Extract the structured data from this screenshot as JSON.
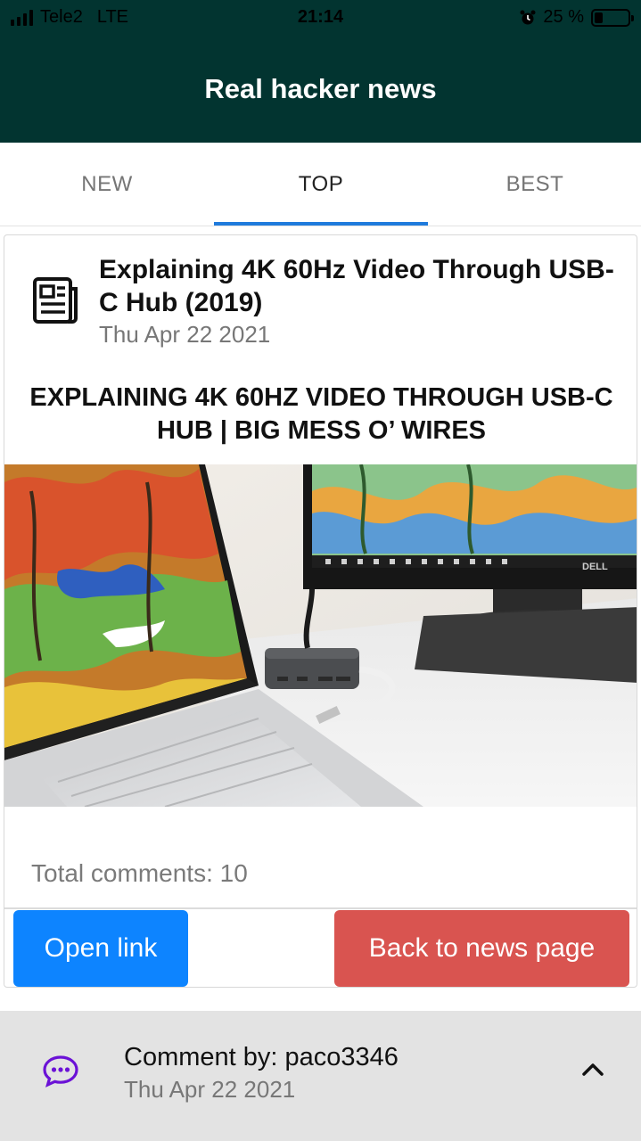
{
  "status_bar": {
    "carrier": "Tele2",
    "network": "LTE",
    "time": "21:14",
    "battery_text": "25 %",
    "battery_level": 0.25
  },
  "app": {
    "title": "Real hacker news"
  },
  "tabs": [
    {
      "label": "NEW",
      "active": false
    },
    {
      "label": "TOP",
      "active": true
    },
    {
      "label": "BEST",
      "active": false
    }
  ],
  "story": {
    "title": "Explaining 4K 60Hz Video Through USB-C Hub (2019)",
    "date": "Thu Apr 22 2021",
    "link_title": "EXPLAINING 4K 60HZ VIDEO THROUGH USB-C HUB | BIG MESS O’ WIRES",
    "image_logo_text": "DELL",
    "comments_text": "Total comments: 10",
    "open_link_label": "Open link",
    "back_label": "Back to news page"
  },
  "comment": {
    "author_text": "Comment by: paco3346",
    "date": "Thu Apr 22 2021"
  },
  "colors": {
    "header": "#023430",
    "tab_indicator": "#1f7bdc",
    "open_button": "#0d84ff",
    "back_button": "#d95450",
    "comment_icon": "#6b12d6"
  },
  "icons": {
    "news": "newspaper-icon",
    "comment": "comment-dots-icon",
    "collapse": "chevron-up-icon"
  }
}
